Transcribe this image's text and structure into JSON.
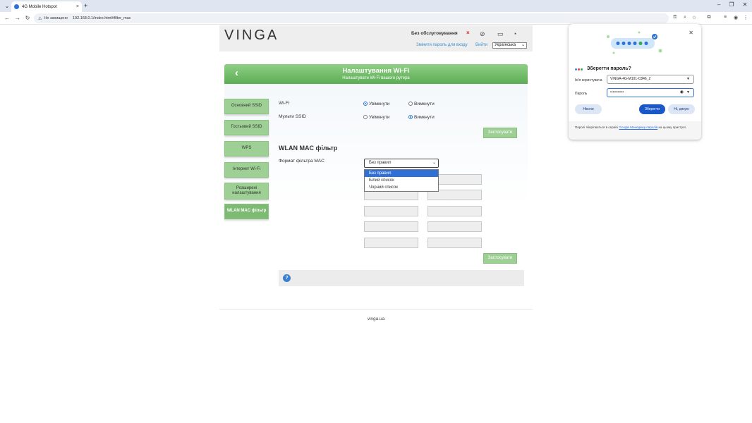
{
  "browser": {
    "tab_title": "4G Mobile Hotspot",
    "tab_close": "×",
    "new_tab": "+",
    "not_secure": "Не захищено",
    "url": "192.168.0.1/index.html#filter_mac"
  },
  "header": {
    "logo": "VINGA",
    "status_text": "Без обслуговування",
    "status_mark": "×",
    "link_change_password": "Змінити пароль для входу",
    "link_logout": "Вийти",
    "language": "Українська"
  },
  "panel": {
    "back": "‹",
    "title": "Налаштування Wi-Fi",
    "subtitle": "Налаштувати Wi-Fi вашого рутера"
  },
  "sidebar": {
    "items": [
      {
        "label": "Основний SSID"
      },
      {
        "label": "Гостьовий SSID"
      },
      {
        "label": "WPS"
      },
      {
        "label": "Інтернет Wi-Fi"
      },
      {
        "label": "Розширені налаштування"
      },
      {
        "label": "WLAN MAC фільтр"
      }
    ]
  },
  "wifi": {
    "wifi_label": "Wi-Fi",
    "multi_ssid_label": "Мульти SSID",
    "on": "Увімкнути",
    "off": "Вимкнути",
    "wifi_value": "Увімкнути",
    "multi_ssid_value": "Вимкнути",
    "apply": "Застосувати"
  },
  "mac_filter": {
    "title": "WLAN MAC фільтр",
    "format_label": "Формат фільтра MAC",
    "selected": "Без правил",
    "options": [
      "Без правил",
      "Білий список",
      "Чорний список"
    ],
    "apply": "Застосувати"
  },
  "help": {
    "icon": "?"
  },
  "footer": {
    "text": "vinga.ua"
  },
  "password_popup": {
    "title": "Зберегти пароль?",
    "username_label": "Ім'я користувача",
    "username_value": "VINGA-4G-M101-C846_2",
    "password_label": "Пароль",
    "password_value": "•••••••••••",
    "never": "Ніколи",
    "save": "Зберегти",
    "no_thanks": "Ні, дякую",
    "note_before": "Паролі зберігаються в сервісі ",
    "note_link": "Google Менеджер паролів",
    "note_after": " на цьому пристрої."
  },
  "colors": {
    "green_header": "#6cba63",
    "green_button": "#9ed095",
    "chrome_blue": "#2f6fd6"
  }
}
